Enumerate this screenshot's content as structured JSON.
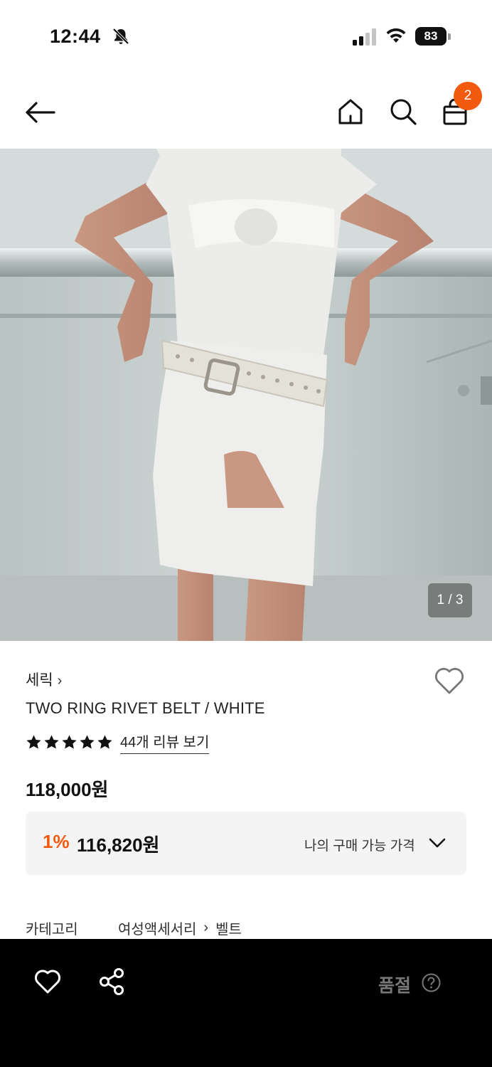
{
  "status_bar": {
    "time": "12:44",
    "battery": "83"
  },
  "header": {
    "cart_count": "2"
  },
  "gallery": {
    "counter": "1 / 3"
  },
  "product": {
    "brand": "세릭",
    "brand_chevron": "›",
    "name": "TWO RING RIVET BELT / WHITE",
    "rating_stars": 5,
    "review_link": "44개 리뷰 보기",
    "price": "118,000원"
  },
  "benefit": {
    "discount_rate": "1%",
    "discount_price": "116,820원",
    "label": "나의 구매 가능 가격"
  },
  "category": {
    "label": "카테고리",
    "level1": "여성액세서리",
    "separator": "›",
    "level2": "벨트"
  },
  "bottom_bar": {
    "status_label": "품절"
  },
  "colors": {
    "accent": "#f25a10",
    "bottom_bar": "#000000",
    "benefit_bg": "#f4f4f4"
  }
}
